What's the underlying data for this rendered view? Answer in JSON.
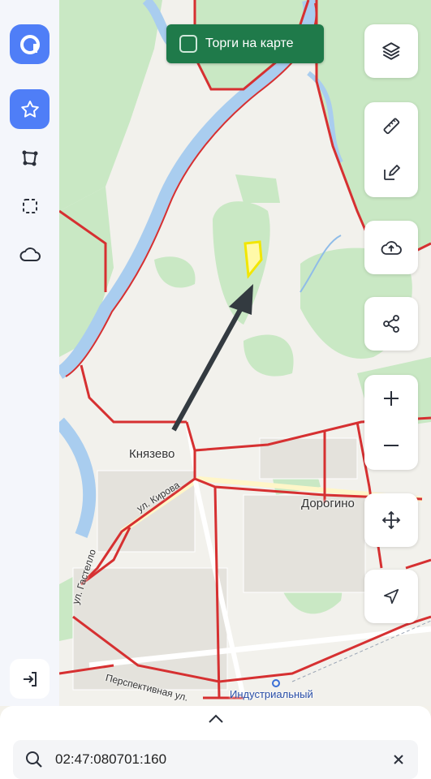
{
  "map": {
    "labels": {
      "knyazevo": "Князево",
      "dorogino": "Дорогино",
      "kirova": "ул. Кирова",
      "gastello": "ул. Гастелло",
      "perspektivnaya": "Перспективная ул.",
      "industrial": "Индустриальный"
    }
  },
  "torgi": {
    "label": "Торги на карте",
    "checked": false
  },
  "sidebar": {
    "items": [
      {
        "icon": "logo-icon",
        "active": false
      },
      {
        "icon": "star-icon",
        "active": true
      },
      {
        "icon": "polygon-icon",
        "active": false
      },
      {
        "icon": "dashed-select-icon",
        "active": false
      },
      {
        "icon": "cloud-icon",
        "active": false
      }
    ],
    "logout_icon": "login-icon"
  },
  "tools": [
    "layers-icon",
    "ruler-icon",
    "edit-icon",
    "upload-cloud-icon",
    "share-icon",
    "zoom-in-icon",
    "zoom-out-icon",
    "move-icon",
    "locate-icon"
  ],
  "search": {
    "value": "02:47:080701:160",
    "placeholder": ""
  },
  "colors": {
    "accent": "#4f7ef7",
    "toggle_bg": "#1f7a4a",
    "boundary": "#d63031",
    "forest": "#c9e8c4",
    "water": "#a9cdef",
    "parcel": "#f2e600"
  }
}
